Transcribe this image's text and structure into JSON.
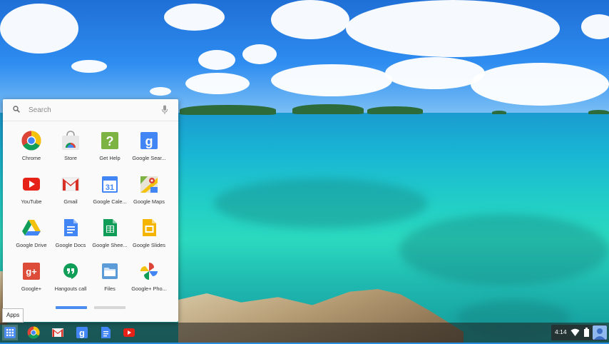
{
  "launcher": {
    "search_placeholder": "Search",
    "apps": [
      {
        "label": "Chrome",
        "icon": "chrome-icon"
      },
      {
        "label": "Store",
        "icon": "store-icon"
      },
      {
        "label": "Get Help",
        "icon": "get-help-icon"
      },
      {
        "label": "Google Sear...",
        "icon": "google-search-icon"
      },
      {
        "label": "YouTube",
        "icon": "youtube-icon"
      },
      {
        "label": "Gmail",
        "icon": "gmail-icon"
      },
      {
        "label": "Google Cale...",
        "icon": "google-calendar-icon",
        "glyph": "31"
      },
      {
        "label": "Google Maps",
        "icon": "google-maps-icon"
      },
      {
        "label": "Google Drive",
        "icon": "google-drive-icon"
      },
      {
        "label": "Google Docs",
        "icon": "google-docs-icon"
      },
      {
        "label": "Google Shee...",
        "icon": "google-sheets-icon"
      },
      {
        "label": "Google Slides",
        "icon": "google-slides-icon"
      },
      {
        "label": "Google+",
        "icon": "google-plus-icon",
        "glyph": "g+"
      },
      {
        "label": "Hangouts call",
        "icon": "hangouts-icon"
      },
      {
        "label": "Files",
        "icon": "files-icon"
      },
      {
        "label": "Google+ Pho...",
        "icon": "google-photos-icon"
      }
    ],
    "pages": {
      "current": 1,
      "total": 2
    }
  },
  "shelf": {
    "tooltip": "Apps",
    "items": [
      "apps-launcher-icon",
      "chrome-icon",
      "gmail-icon",
      "google-search-icon",
      "google-docs-icon",
      "youtube-icon"
    ]
  },
  "status_tray": {
    "time": "4:14",
    "icons": [
      "wifi-icon",
      "battery-icon",
      "avatar"
    ]
  },
  "colors": {
    "accent": "#4a8cf0",
    "launcher_bg": "#fafafa",
    "shelf_bg": "#333333"
  }
}
